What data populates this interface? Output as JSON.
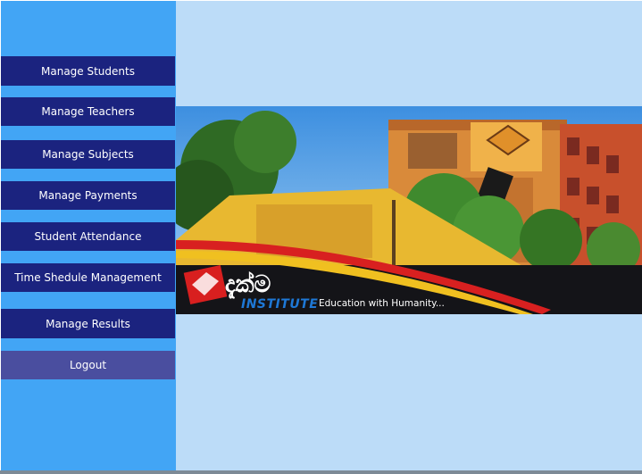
{
  "sidebar": {
    "items": [
      {
        "label": "Manage Students"
      },
      {
        "label": "Manage Teachers"
      },
      {
        "label": "Manage Subjects"
      },
      {
        "label": "Manage Payments"
      },
      {
        "label": "Student Attendance"
      },
      {
        "label": "Time Shedule Management"
      },
      {
        "label": "Manage Results"
      }
    ],
    "logout_label": "Logout"
  },
  "banner": {
    "logo_sinhala": "දැක්ම",
    "logo_word": "INSTITUTE",
    "tagline": "Education with Humanity..."
  },
  "colors": {
    "sidebar_bg": "#42a5f5",
    "button_bg": "#1b237f",
    "logout_bg": "#4a4e9f",
    "content_bg": "#bcdcf8"
  }
}
